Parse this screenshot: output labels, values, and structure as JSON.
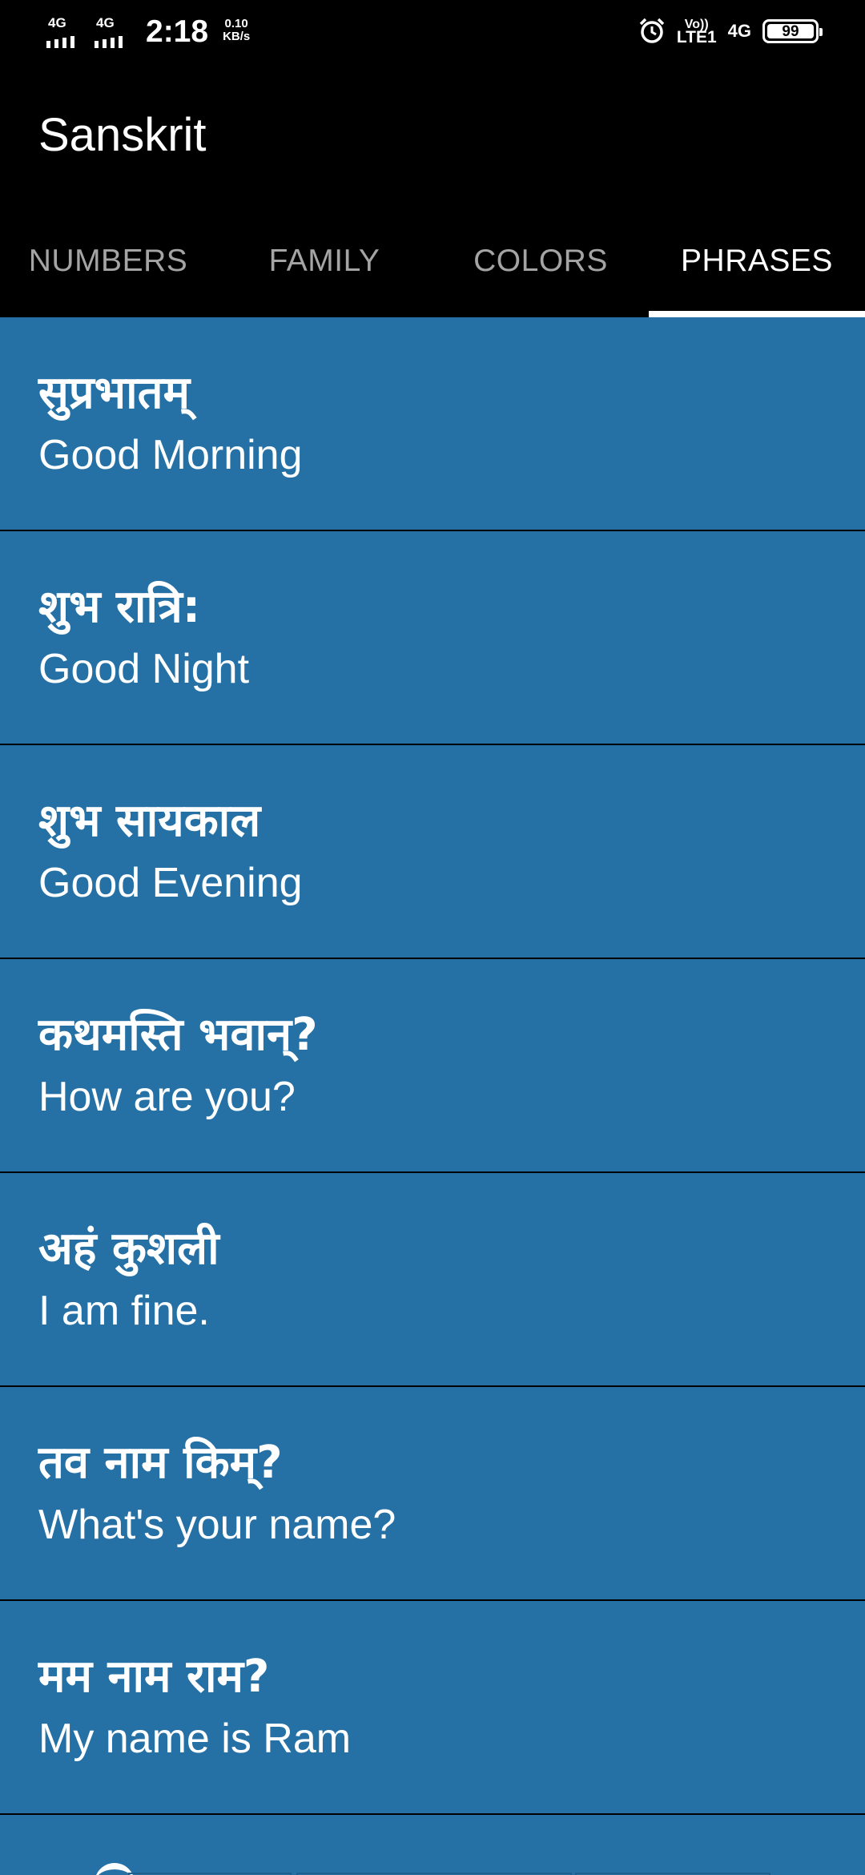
{
  "status_bar": {
    "network_1": "4G",
    "network_2": "4G",
    "time": "2:18",
    "speed_value": "0.10",
    "speed_unit": "KB/s",
    "volte_top": "Vo))",
    "volte_bottom": "LTE1",
    "network_right": "4G",
    "battery": "99",
    "icons": [
      "signal-icon",
      "alarm-icon",
      "battery-icon"
    ]
  },
  "app_bar": {
    "title": "Sanskrit"
  },
  "tabs": [
    {
      "label": "NUMBERS",
      "active": false
    },
    {
      "label": "FAMILY",
      "active": false
    },
    {
      "label": "COLORS",
      "active": false
    },
    {
      "label": "PHRASES",
      "active": true
    }
  ],
  "colors": {
    "background": "#000000",
    "list_item": "#2571a6",
    "tab_inactive": "#a4a4a4",
    "tab_active": "#ffffff"
  },
  "phrases": [
    {
      "sanskrit": "सुप्रभातम्",
      "english": "Good Morning"
    },
    {
      "sanskrit": "शुभ रात्रि:",
      "english": "Good Night"
    },
    {
      "sanskrit": "शुभ सायकाल",
      "english": "Good Evening"
    },
    {
      "sanskrit": "कथमस्ति भवान्?",
      "english": "How are you?"
    },
    {
      "sanskrit": "अहं कुशली",
      "english": "I am fine."
    },
    {
      "sanskrit": "तव नाम किम्?",
      "english": "What's your name?"
    },
    {
      "sanskrit": "मम नाम राम?",
      "english": "My name is Ram"
    }
  ]
}
